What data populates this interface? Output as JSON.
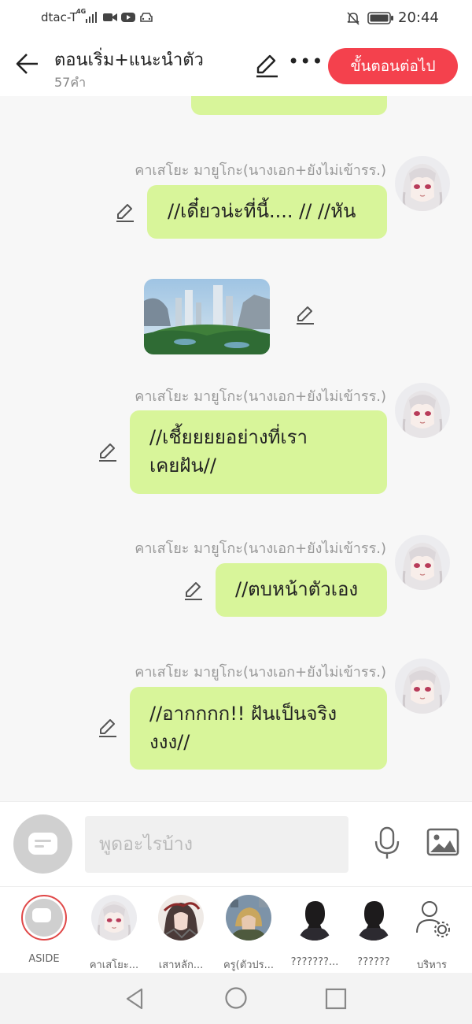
{
  "status_bar": {
    "carrier": "dtac-T",
    "network": "4G",
    "time": "20:44"
  },
  "header": {
    "title": "ตอนเริ่ม+แนะนำตัว",
    "subtitle": "57คำ",
    "next_button": "ขั้นตอนต่อไป"
  },
  "messages": [
    {
      "speaker": "คาเสโยะ มายูโกะ(นางเอก+ยังไม่เข้ารร.)",
      "text": "//เดี๋ยวน่ะที่นี้.... // //หัน"
    },
    {
      "speaker": "คาเสโยะ มายูโกะ(นางเอก+ยังไม่เข้ารร.)",
      "line1": "//เชี้ยยยยอย่างที่เรา",
      "line2": "เคยฝัน//"
    },
    {
      "speaker": "คาเสโยะ มายูโกะ(นางเอก+ยังไม่เข้ารร.)",
      "text": "//ตบหน้าตัวเอง"
    },
    {
      "speaker": "คาเสโยะ มายูโกะ(นางเอก+ยังไม่เข้ารร.)",
      "line1": "//อากกกก!! ฝันเป็นจริง",
      "line2": "งงง//"
    }
  ],
  "input": {
    "placeholder": "พูดอะไรบ้าง"
  },
  "characters": [
    {
      "label": "ASIDE"
    },
    {
      "label": "คาเสโยะ..."
    },
    {
      "label": "เสาหลัก..."
    },
    {
      "label": "ครู(ตัวปร..."
    },
    {
      "label": "???????..."
    },
    {
      "label": "??????"
    },
    {
      "label": "บริหาร"
    }
  ],
  "colors": {
    "accent": "#f4414d",
    "bubble": "#d8f59a"
  }
}
